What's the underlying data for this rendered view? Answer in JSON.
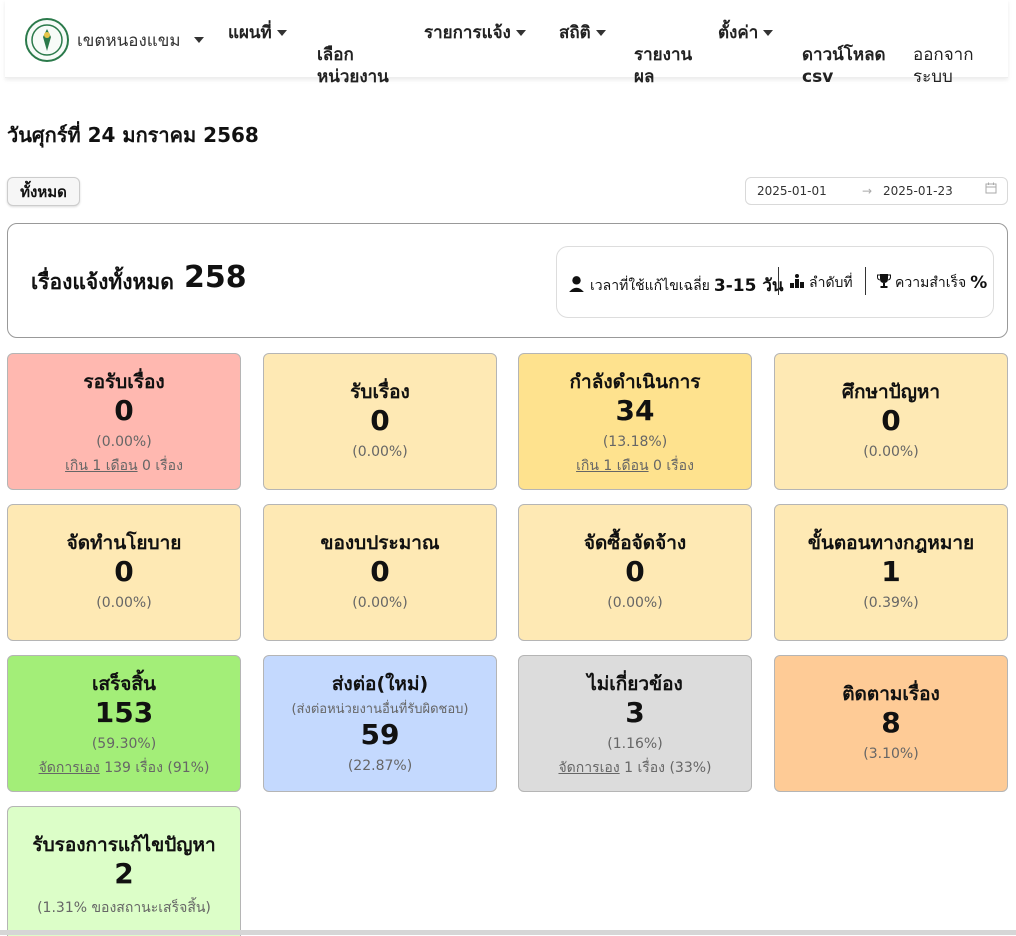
{
  "nav": {
    "brand": "เขตหนองแขม",
    "items": [
      {
        "label": "แผนที่",
        "dropdown": true
      },
      {
        "label": "เลือก\nหน่วยงาน",
        "dropdown": false
      },
      {
        "label": "รายการแจ้ง",
        "dropdown": true
      },
      {
        "label": "สถิติ",
        "dropdown": true
      },
      {
        "label": "รายงาน\nผล",
        "dropdown": false
      },
      {
        "label": "ตั้งค่า",
        "dropdown": true
      },
      {
        "label": "ดาวน์โหลด\ncsv",
        "dropdown": false
      },
      {
        "label": "ออกจาก\nระบบ",
        "dropdown": false
      }
    ]
  },
  "date_title": "วันศุกร์ที่ 24 มกราคม 2568",
  "filter": {
    "all_label": "ทั้งหมด",
    "start": "2025-01-01",
    "end": "2025-01-23"
  },
  "summary": {
    "label": "เรื่องแจ้งทั้งหมด",
    "total": "258",
    "avg_prefix": "เวลาที่ใช้แก้ไขเฉลี่ย",
    "avg_value": "3-15 วัน",
    "rank_label": "ลำดับที่",
    "success_label": "ความสำเร็จ",
    "success_value": "%"
  },
  "cards": [
    {
      "title": "รอรับเรื่อง",
      "value": "0",
      "pct": "(0.00%)",
      "link": "เกิน 1 เดือน",
      "extra": " 0 เรื่อง",
      "color": "#ffb8b0"
    },
    {
      "title": "รับเรื่อง",
      "value": "0",
      "pct": "(0.00%)",
      "color": "#fee9b4"
    },
    {
      "title": "กำลังดำเนินการ",
      "value": "34",
      "pct": "(13.18%)",
      "link": "เกิน 1 เดือน",
      "extra": " 0 เรื่อง",
      "color": "#fee28e"
    },
    {
      "title": "ศึกษาปัญหา",
      "value": "0",
      "pct": "(0.00%)",
      "color": "#fee9b4"
    },
    {
      "title": "จัดทำนโยบาย",
      "value": "0",
      "pct": "(0.00%)",
      "color": "#fee9b4"
    },
    {
      "title": "ของบประมาณ",
      "value": "0",
      "pct": "(0.00%)",
      "color": "#fee9b4"
    },
    {
      "title": "จัดซื้อจัดจ้าง",
      "value": "0",
      "pct": "(0.00%)",
      "color": "#fee9b4"
    },
    {
      "title": "ขั้นตอนทางกฎหมาย",
      "value": "1",
      "pct": "(0.39%)",
      "color": "#fee9b4"
    },
    {
      "title": "เสร็จสิ้น",
      "value": "153",
      "pct": "(59.30%)",
      "link": "จัดการเอง",
      "extra": " 139 เรื่อง (91%)",
      "color": "#a3ee78"
    },
    {
      "title": "ส่งต่อ(ใหม่)",
      "sub": "(ส่งต่อหน่วยงานอื่นที่รับผิดชอบ)",
      "value": "59",
      "pct": "(22.87%)",
      "color": "#c4d9fe"
    },
    {
      "title": "ไม่เกี่ยวข้อง",
      "value": "3",
      "pct": "(1.16%)",
      "link": "จัดการเอง",
      "extra": " 1 เรื่อง (33%)",
      "color": "#dcdcdc"
    },
    {
      "title": "ติดตามเรื่อง",
      "value": "8",
      "pct": "(3.10%)",
      "color": "#fecb96"
    },
    {
      "title": "รับรองการแก้ไขปัญหา",
      "value": "2",
      "pct": "(1.31% ของสถานะเสร็จสิ้น)",
      "color": "#dcfec8"
    }
  ]
}
